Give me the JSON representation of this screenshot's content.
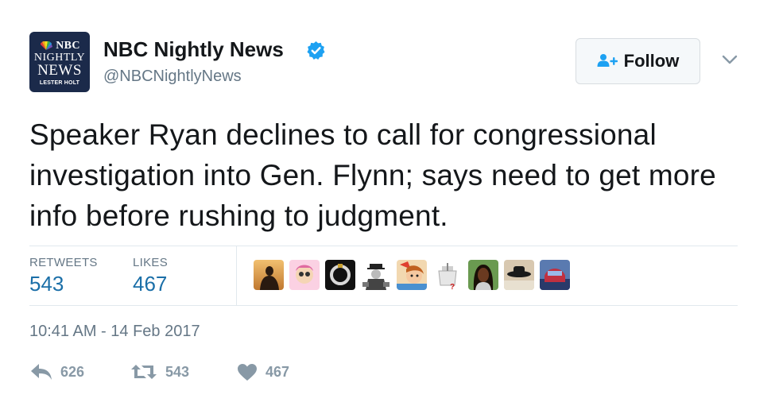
{
  "author": {
    "display_name": "NBC Nightly News",
    "handle": "@NBCNightlyNews",
    "verified": true,
    "avatar": {
      "logo_text": "NBC",
      "line1": "NIGHTLY",
      "line2": "NEWS",
      "line3": "LESTER HOLT"
    }
  },
  "follow_button": {
    "label": "Follow",
    "icon": "add-user-icon"
  },
  "tweet": {
    "text": "Speaker Ryan declines to call for congressional investigation into Gen. Flynn; says need to get more info before rushing to judgment.",
    "timestamp": "10:41 AM - 14 Feb 2017"
  },
  "stats": {
    "retweets_label": "RETWEETS",
    "retweets_value": "543",
    "likes_label": "LIKES",
    "likes_value": "467"
  },
  "likers": [
    {
      "name": "liker-1",
      "color": "#d9a060"
    },
    {
      "name": "liker-2",
      "color": "#f3a8c8"
    },
    {
      "name": "liker-3",
      "color": "#111111"
    },
    {
      "name": "liker-4",
      "color": "#9a9a9a"
    },
    {
      "name": "liker-5",
      "color": "#e8c090"
    },
    {
      "name": "liker-6",
      "color": "#ffffff"
    },
    {
      "name": "liker-7",
      "color": "#4a8a3a"
    },
    {
      "name": "liker-8",
      "color": "#c8b8a0"
    },
    {
      "name": "liker-9",
      "color": "#3a5a9a"
    }
  ],
  "actions": {
    "reply_count": "626",
    "retweet_count": "543",
    "like_count": "467"
  },
  "colors": {
    "verified": "#1da1f2",
    "link_blue": "#1b6fa8",
    "muted": "#657786",
    "icon_gray": "#8899a6"
  }
}
